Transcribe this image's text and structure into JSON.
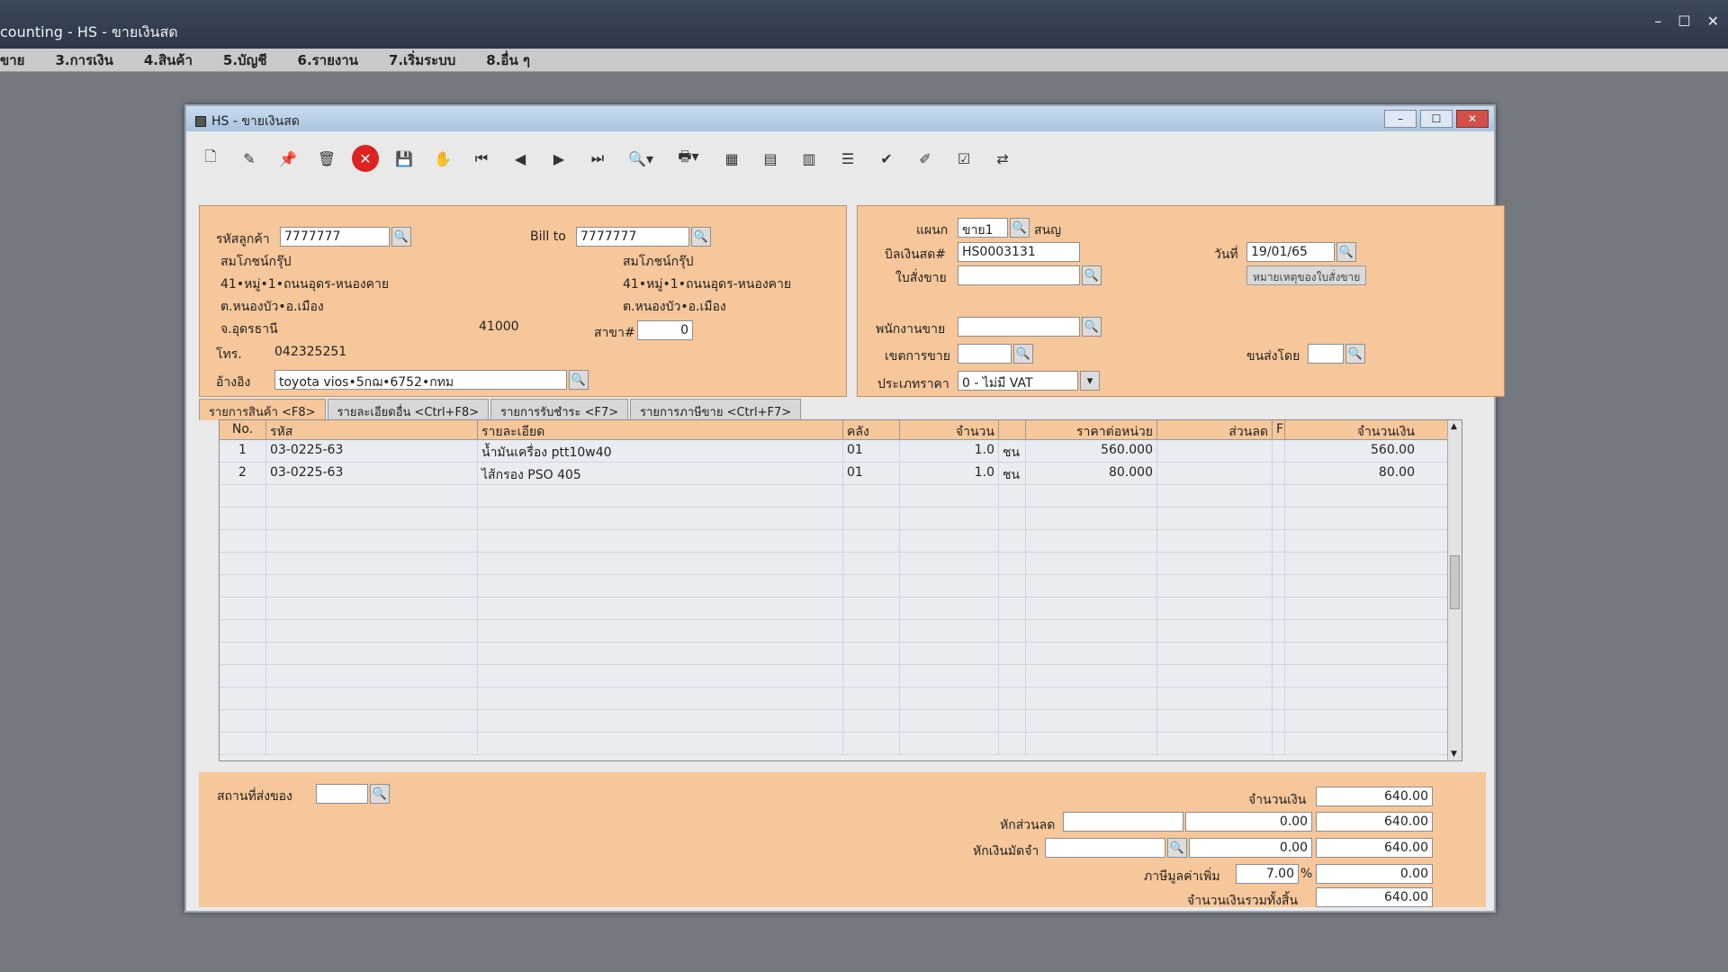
{
  "app": {
    "title": "counting - HS - ขายเงินสด",
    "menu": [
      "ขาย",
      "3.การเงิน",
      "4.สินค้า",
      "5.บัญชี",
      "6.รายงาน",
      "7.เริ่มระบบ",
      "8.อื่น ๆ"
    ]
  },
  "window": {
    "title": "HS - ขายเงินสด"
  },
  "toolbar": {
    "icons": [
      "new-doc-icon",
      "edit-icon",
      "pin-icon",
      "trash-icon",
      "cancel-icon",
      "save-icon",
      "hand-icon",
      "first-icon",
      "prev-icon",
      "next-icon",
      "last-icon",
      "find-icon",
      "print-icon",
      "calc-icon",
      "sheet-icon",
      "barcode-icon",
      "list-icon",
      "ok-icon",
      "pen-icon",
      "ok2-icon",
      "transfer-icon"
    ]
  },
  "customer": {
    "code_label": "รหัสลูกค้า",
    "code": "7777777",
    "name": "สมโภชน์กรุ๊ป",
    "addr1": "41•หมู่•1•ถนนอุดร-หนองคาย",
    "addr2": "ต.หนองบัว•อ.เมือง",
    "addr3": "จ.อุดรธานี",
    "zip": "41000",
    "phone_label": "โทร.",
    "phone": "042325251",
    "ref_label": "อ้างอิง",
    "ref": "toyota vios•5กฌ•6752•กทม"
  },
  "billto": {
    "label": "Bill to",
    "code": "7777777",
    "name": "สมโภชน์กรุ๊ป",
    "addr1": "41•หมู่•1•ถนนอุดร-หนองคาย",
    "addr2": "ต.หนองบัว•อ.เมือง",
    "branch_label": "สาขา#",
    "branch": "0"
  },
  "doc": {
    "dept_label": "แผนก",
    "dept": "ขาย1",
    "dept_name": "สนญ",
    "bill_label": "บิลเงินสด#",
    "bill_no": "HS0003131",
    "order_label": "ใบสั่งขาย",
    "order_no": "",
    "date_label": "วันที่",
    "date": "19/01/65",
    "note_button": "หมายเหตุของใบสั่งขาย",
    "salesman_label": "พนักงานขาย",
    "salesman": "",
    "area_label": "เขตการขาย",
    "area": "",
    "ship_label": "ขนส่งโดย",
    "ship": "",
    "price_type_label": "ประเภทราคา",
    "price_type": "0 - ไม่มี VAT"
  },
  "tabs": [
    {
      "label": "รายการสินค้า <F8>",
      "active": true
    },
    {
      "label": "รายละเอียดอื่น <Ctrl+F8>",
      "active": false
    },
    {
      "label": "รายการรับชำระ <F7>",
      "active": false
    },
    {
      "label": "รายการภาษีขาย <Ctrl+F7>",
      "active": false
    }
  ],
  "grid": {
    "headers": [
      "No.",
      "รหัส",
      "รายละเอียด",
      "คลัง",
      "จำนวน",
      "",
      "ราคาต่อหน่วย",
      "ส่วนลด",
      "F",
      "จำนวนเงิน"
    ],
    "rows": [
      {
        "no": "1",
        "code": "03-0225-63",
        "desc": "น้ำมันเครื่อง ptt10w40",
        "wh": "01",
        "qty": "1.0",
        "unit": "ชน",
        "price": "560.000",
        "disc": "",
        "f": "",
        "amount": "560.00"
      },
      {
        "no": "2",
        "code": "03-0225-63",
        "desc": "ไส้กรอง PSO 405",
        "wh": "01",
        "qty": "1.0",
        "unit": "ชน",
        "price": "80.000",
        "disc": "",
        "f": "",
        "amount": "80.00"
      }
    ]
  },
  "footer": {
    "delivery_label": "สถานที่ส่งของ",
    "delivery": "",
    "amount_label": "จำนวนเงิน",
    "amount": "640.00",
    "discount_label": "หักส่วนลด",
    "discount_text": "",
    "discount": "0.00",
    "after_discount": "640.00",
    "deposit_label": "หักเงินมัดจำ",
    "deposit_text": "",
    "deposit": "0.00",
    "after_deposit": "640.00",
    "vat_label": "ภาษีมูลค่าเพิ่ม",
    "vat_rate": "7.00",
    "vat_pct": "%",
    "vat": "0.00",
    "total_label": "จำนวนเงินรวมทั้งสิ้น",
    "total": "640.00"
  }
}
